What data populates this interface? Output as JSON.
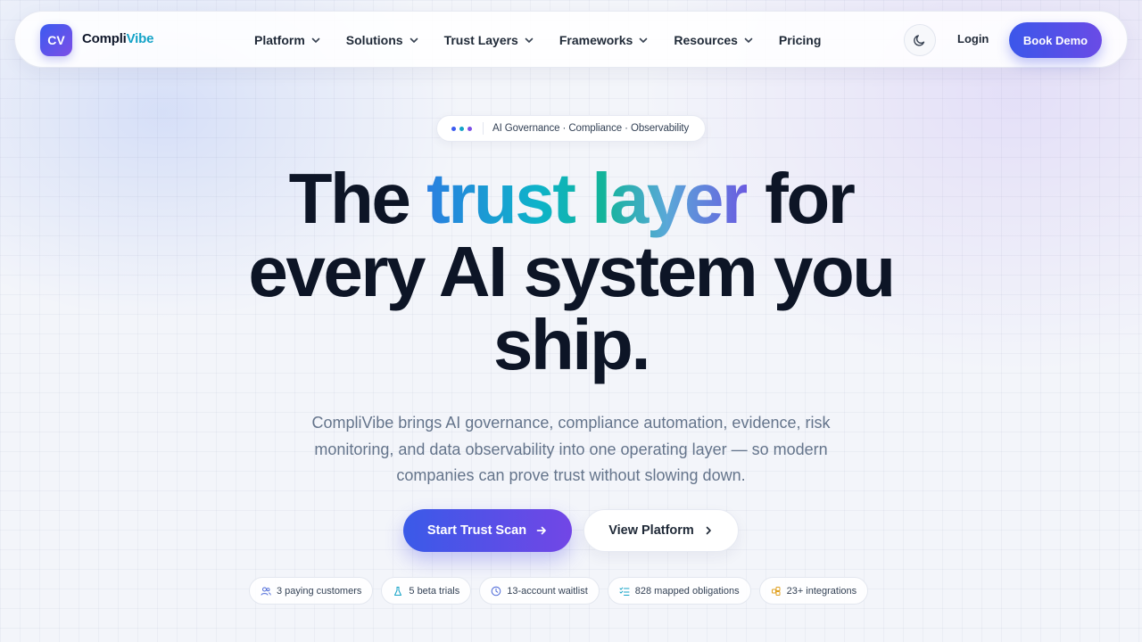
{
  "brand": {
    "mark": "CV",
    "name_part1": "Compli",
    "name_part2": "Vibe",
    "accent": "#14a3c7"
  },
  "nav": {
    "items": [
      {
        "label": "Platform",
        "has_dropdown": true
      },
      {
        "label": "Solutions",
        "has_dropdown": true
      },
      {
        "label": "Trust Layers",
        "has_dropdown": true
      },
      {
        "label": "Frameworks",
        "has_dropdown": true
      },
      {
        "label": "Resources",
        "has_dropdown": true
      },
      {
        "label": "Pricing",
        "has_dropdown": false
      }
    ],
    "theme_icon": "moon-icon",
    "login": "Login",
    "cta": "Book Demo"
  },
  "badge": {
    "text": "AI Governance · Compliance · Observability",
    "dot_colors": [
      "#3b5bf0",
      "#14a3c7",
      "#7c4ee6"
    ]
  },
  "hero": {
    "line1_start": "The ",
    "highlight": "trust layer",
    "line1_end": " for",
    "line2": "every AI system you",
    "line3": "ship.",
    "subtitle": "CompliVibe brings AI governance, compliance automation, evidence, risk monitoring, and data observability into one operating layer — so modern companies can prove trust without slowing down.",
    "primary_cta": "Start Trust Scan",
    "secondary_cta": "View Platform"
  },
  "stats": [
    {
      "icon": "users-icon",
      "label": "3 paying customers"
    },
    {
      "icon": "flask-icon",
      "label": "5 beta trials"
    },
    {
      "icon": "clock-icon",
      "label": "13-account waitlist"
    },
    {
      "icon": "checklist-icon",
      "label": "828 mapped obligations"
    },
    {
      "icon": "puzzle-icon",
      "label": "23+ integrations"
    }
  ],
  "colors": {
    "primary_gradient_start": "#3a5ae8",
    "primary_gradient_end": "#7246e6",
    "heading": "#0d1526",
    "body_text": "#64748b"
  }
}
